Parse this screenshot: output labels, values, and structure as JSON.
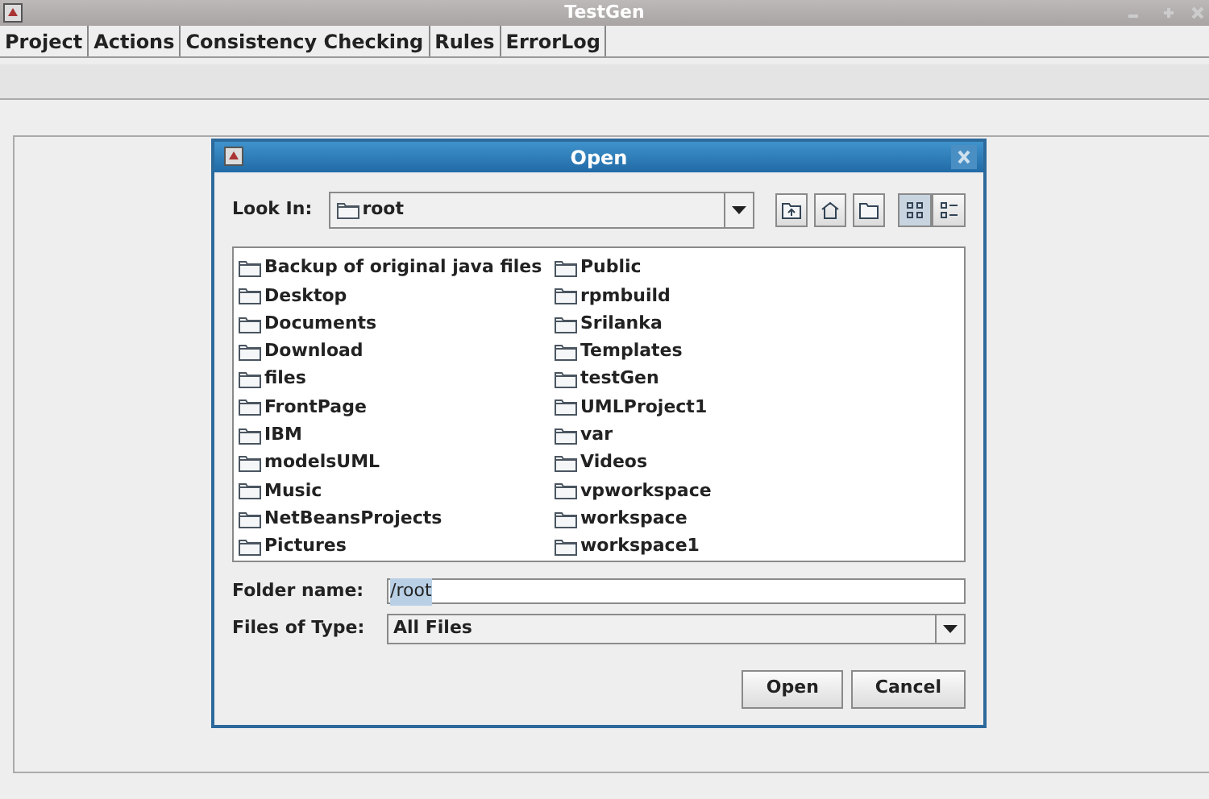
{
  "window": {
    "title": "TestGen"
  },
  "menu": [
    "Project",
    "Actions",
    "Consistency Checking",
    "Rules",
    "ErrorLog"
  ],
  "dialog": {
    "title": "Open",
    "look_in": {
      "label": "Look In:",
      "value": "root"
    },
    "view_buttons": [
      {
        "kind": "list",
        "selected": true
      },
      {
        "kind": "details",
        "selected": false
      }
    ],
    "files": [
      [
        "Backup of original java files",
        "Desktop",
        "Documents",
        "Download",
        "files",
        "FrontPage",
        "IBM",
        "modelsUML",
        "Music",
        "NetBeansProjects",
        "Pictures"
      ],
      [
        "Public",
        "rpmbuild",
        "Srilanka",
        "Templates",
        "testGen",
        "UMLProject1",
        "var",
        "Videos",
        "vpworkspace",
        "workspace",
        "workspace1"
      ]
    ],
    "folder_name": {
      "label": "Folder name:",
      "value": "/root",
      "text_selected": true
    },
    "file_type": {
      "label": "Files of Type:",
      "value": "All Files"
    },
    "buttons": [
      "Open",
      "Cancel"
    ]
  }
}
